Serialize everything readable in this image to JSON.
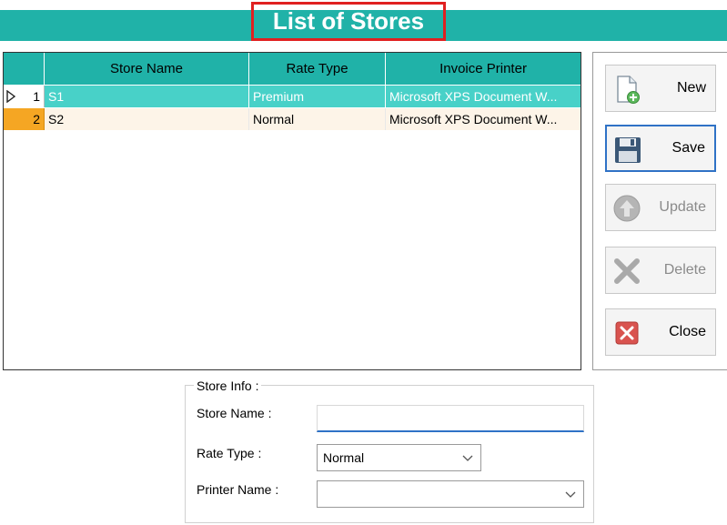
{
  "title": "List of Stores",
  "grid": {
    "columns": [
      "Store Name",
      "Rate Type",
      "Invoice Printer"
    ],
    "rows": [
      {
        "num": "1",
        "store": "S1",
        "rate": "Premium",
        "printer": "Microsoft XPS Document W..."
      },
      {
        "num": "2",
        "store": "S2",
        "rate": "Normal",
        "printer": "Microsoft XPS Document W..."
      }
    ],
    "selected_row_color": "#48d1c8",
    "alt_row_color": "#fdf4e8",
    "row_header_active_color": "#f5a623"
  },
  "buttons": {
    "new": "New",
    "save": "Save",
    "update": "Update",
    "delete": "Delete",
    "close": "Close"
  },
  "form": {
    "legend": "Store Info :",
    "store_name_label": "Store Name :",
    "store_name_value": "",
    "rate_type_label": "Rate Type :",
    "rate_type_value": "Normal",
    "printer_name_label": "Printer Name :",
    "printer_name_value": ""
  },
  "colors": {
    "accent": "#20b2a8",
    "title_border": "#e02020"
  },
  "icons": {
    "new": "new-document-plus-icon",
    "save": "floppy-disk-icon",
    "update": "up-arrow-circle-icon",
    "delete": "x-mark-icon",
    "close": "red-close-icon",
    "row_pointer": "row-pointer-icon",
    "dropdown": "chevron-down-icon"
  }
}
